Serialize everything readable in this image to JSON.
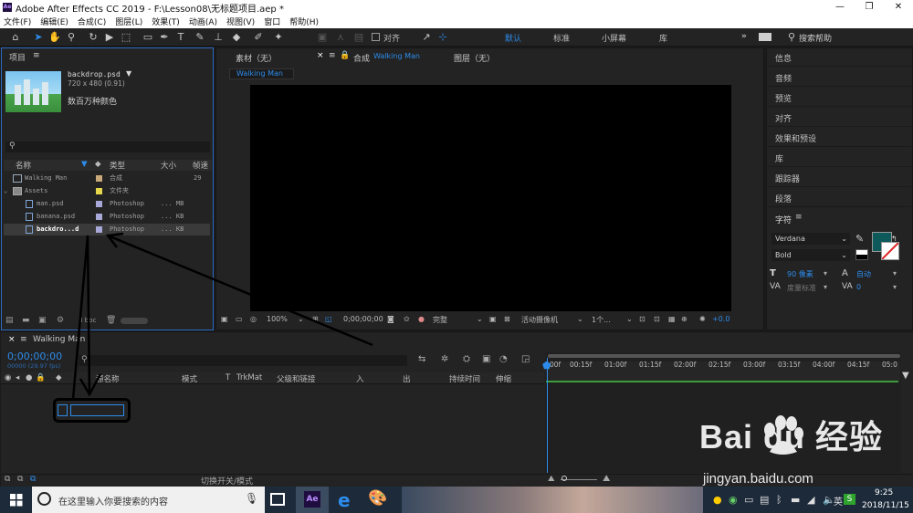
{
  "window": {
    "title": "Adobe After Effects CC 2019 - F:\\Lesson08\\无标题项目.aep *",
    "app_icon": "Ae"
  },
  "menu": [
    "文件(F)",
    "编辑(E)",
    "合成(C)",
    "图层(L)",
    "效果(T)",
    "动画(A)",
    "视图(V)",
    "窗口",
    "帮助(H)"
  ],
  "toolbar": {
    "align_label": "对齐",
    "workspaces": [
      "默认",
      "标准",
      "小屏幕",
      "库"
    ],
    "search_placeholder": "搜索帮助",
    "overflow": "»"
  },
  "project": {
    "title": "项目",
    "selected_name": "backdrop.psd",
    "selected_info": "720 x 480 (0.91)",
    "selected_color": "数百万种颜色",
    "columns": {
      "name": "名称",
      "type": "类型",
      "size": "大小",
      "fps": "帧速"
    },
    "items": [
      {
        "name": "Walking Man",
        "swatch": "#c9a87a",
        "type": "合成",
        "size": "",
        "fps": "29",
        "icon": "composition-icon",
        "indent": 0
      },
      {
        "name": "Assets",
        "swatch": "#e7d74a",
        "type": "文件夹",
        "size": "",
        "fps": "",
        "icon": "folder-icon",
        "indent": 0
      },
      {
        "name": "man.psd",
        "swatch": "#a7a7d8",
        "type": "Photoshop",
        "size": "... MB",
        "fps": "",
        "icon": "psd-file-icon",
        "indent": 1
      },
      {
        "name": "banana.psd",
        "swatch": "#a7a7d8",
        "type": "Photoshop",
        "size": "... KB",
        "fps": "",
        "icon": "psd-file-icon",
        "indent": 1
      },
      {
        "name": "backdro...d",
        "swatch": "#a7a7d8",
        "type": "Photoshop",
        "size": "... KB",
        "fps": "",
        "icon": "psd-file-icon",
        "indent": 1
      }
    ],
    "bpc": "8 bpc"
  },
  "comp": {
    "tabs": {
      "footage": "素材（无）",
      "composition_prefix": "合成",
      "composition_name": "Walking Man",
      "layer": "图层（无）"
    },
    "breadcrumb": "Walking Man",
    "viewer_bar": {
      "zoom": "100%",
      "timecode": "0;00;00;00",
      "resolution": "完整",
      "camera": "活动摄像机",
      "views": "1个...",
      "exposure": "+0.0"
    }
  },
  "right_panel": {
    "items": [
      "信息",
      "音频",
      "预览",
      "对齐",
      "效果和预设",
      "库",
      "跟踪器",
      "段落"
    ],
    "character": {
      "title": "字符",
      "font": "Verdana",
      "style": "Bold",
      "size": "90 像素",
      "leading": "自动",
      "kerning": "度量标准",
      "tracking": "0",
      "fill_color": "#0e5a5a"
    }
  },
  "timeline": {
    "tab": "Walking Man",
    "timecode": "0;00;00;00",
    "fps_info": "00000 (29.97 fps)",
    "columns": {
      "layer_name": "源名称",
      "mode": "模式",
      "t": "T",
      "trkmat": "TrkMat",
      "parent": "父级和链接",
      "in": "入",
      "out": "出",
      "duration": "持续时间",
      "stretch": "伸缩"
    },
    "ruler": [
      "00f",
      "00:15f",
      "01:00f",
      "01:15f",
      "02:00f",
      "02:15f",
      "03:00f",
      "03:15f",
      "04:00f",
      "04:15f",
      "05:0"
    ],
    "toggle_label": "切换开关/模式"
  },
  "taskbar": {
    "search_placeholder": "在这里输入你要搜索的内容",
    "time": "9:25",
    "date": "2018/11/15"
  },
  "watermark": {
    "brand": "Bai du 经验",
    "url": "jingyan.baidu.com"
  },
  "colors": {
    "accent": "#2d8ceb",
    "label_comp": "#c9a87a",
    "label_folder": "#e7d74a",
    "label_psd": "#a7a7d8",
    "playhead_bar": "#3d9c3d"
  }
}
